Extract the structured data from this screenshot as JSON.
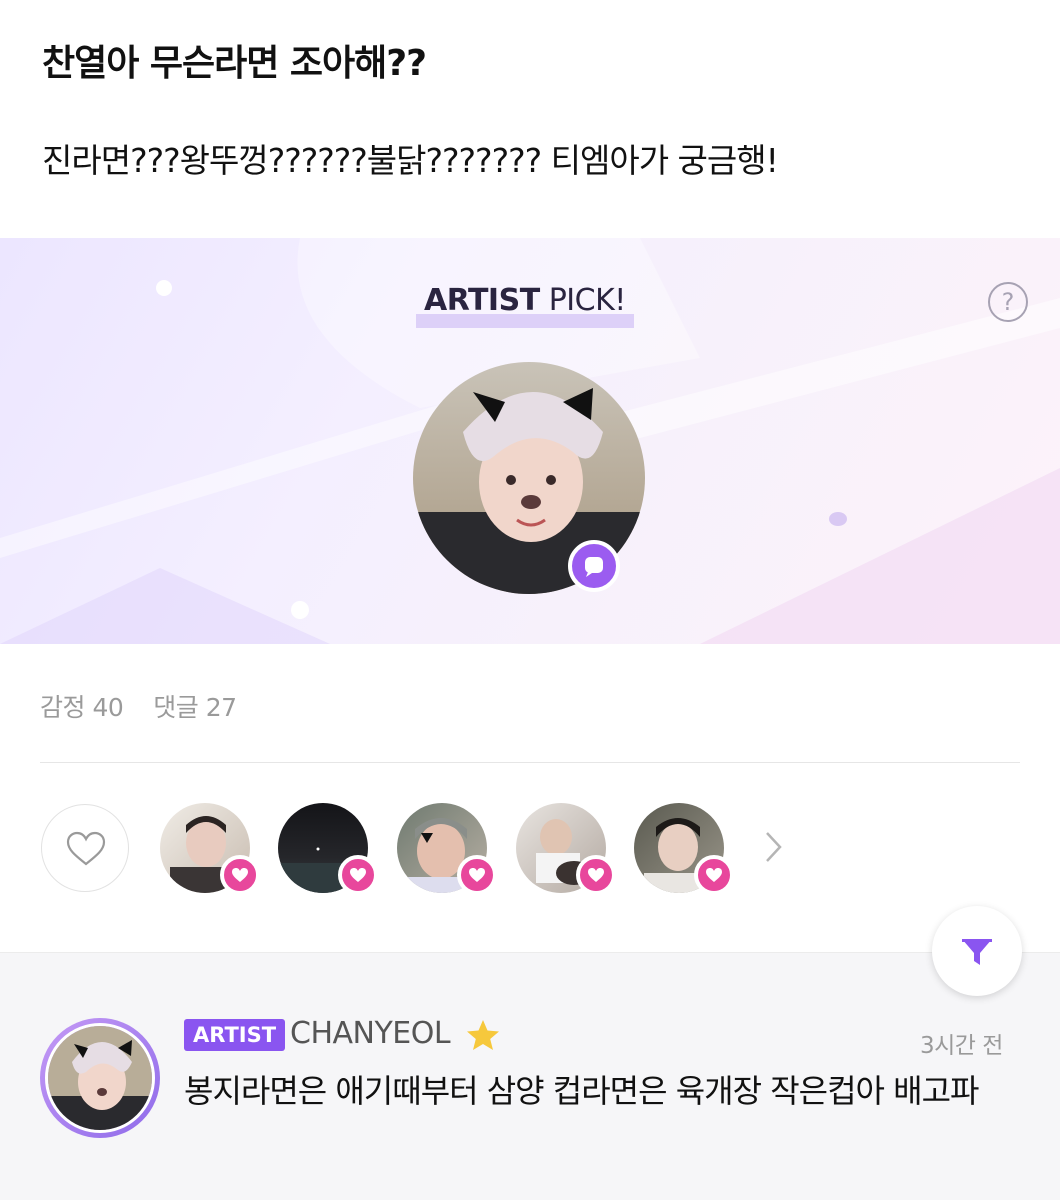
{
  "post": {
    "title": "찬열아 무슨라면 조아해??",
    "body": "진라면???왕뚜껑??????불닭??????? 티엠아가 궁금행!"
  },
  "artist_pick": {
    "title_bold": "ARTIST",
    "title_regular": " PICK!",
    "help_label": "?",
    "avatar_icon": "profile-photo",
    "badge_icon": "chat-bubble-icon"
  },
  "stats": {
    "emotions": "감정 40",
    "comments": "댓글 27"
  },
  "reactions": {
    "like_icon": "heart-outline-icon",
    "reactor_badge_icon": "heart-icon",
    "more_icon": "chevron-right-icon",
    "colors": {
      "badge": "#e8479c"
    }
  },
  "comment": {
    "badge": "ARTIST",
    "author": "CHANYEOL",
    "time": "3시간 전",
    "text": "봉지라면은 애기때부터 삼양 컵라면은 육개장 작은컵아 배고파"
  },
  "filter": {
    "icon": "funnel-icon"
  },
  "colors": {
    "accent": "#8a55f0",
    "banner": "#ece6ff"
  }
}
